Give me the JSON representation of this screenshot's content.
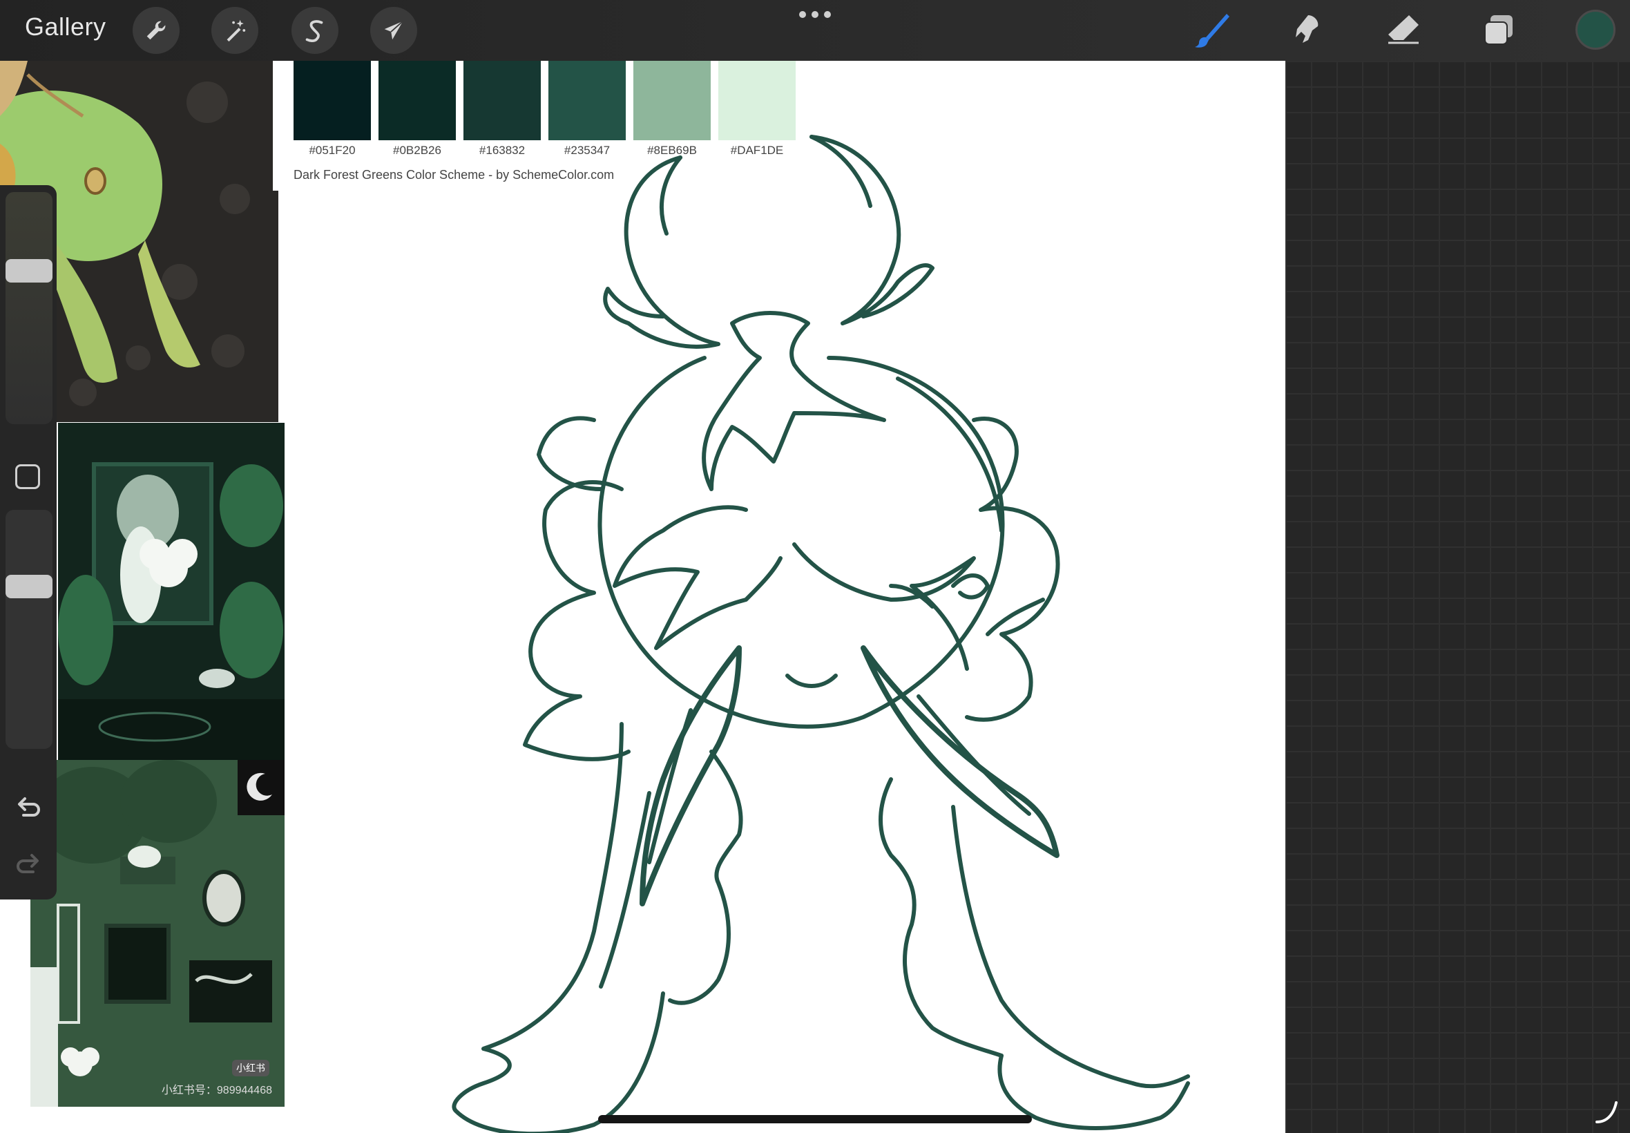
{
  "toolbar": {
    "gallery_label": "Gallery",
    "left_tools": [
      "wrench-icon",
      "magic-wand-icon",
      "selection-s-icon",
      "transform-arrow-icon"
    ],
    "more_icon": "ellipsis-icon",
    "right_tools": [
      "brush-icon",
      "smudge-icon",
      "eraser-icon",
      "layers-icon"
    ],
    "active_color": "#235347"
  },
  "palette": {
    "swatches": [
      {
        "hex": "#051F20",
        "label": "#051F20"
      },
      {
        "hex": "#0B2B26",
        "label": "#0B2B26"
      },
      {
        "hex": "#163832",
        "label": "#163832"
      },
      {
        "hex": "#235347",
        "label": "#235347"
      },
      {
        "hex": "#8EB69B",
        "label": "#8EB69B"
      },
      {
        "hex": "#DAF1DE",
        "label": "#DAF1DE"
      }
    ],
    "caption": "Dark Forest Greens  Color Scheme - by SchemeColor.com"
  },
  "references": {
    "watermark": "小红书号：989944468",
    "badge": "小红书"
  },
  "sidebar": {
    "brush_size_level": 0.68,
    "opacity_level": 0.7,
    "modifier_icon": "square-modifier-icon",
    "undo_icon": "undo-icon",
    "redo_icon": "redo-icon"
  },
  "colors": {
    "stroke": "#235347",
    "brush_active": "#2f7be6"
  }
}
